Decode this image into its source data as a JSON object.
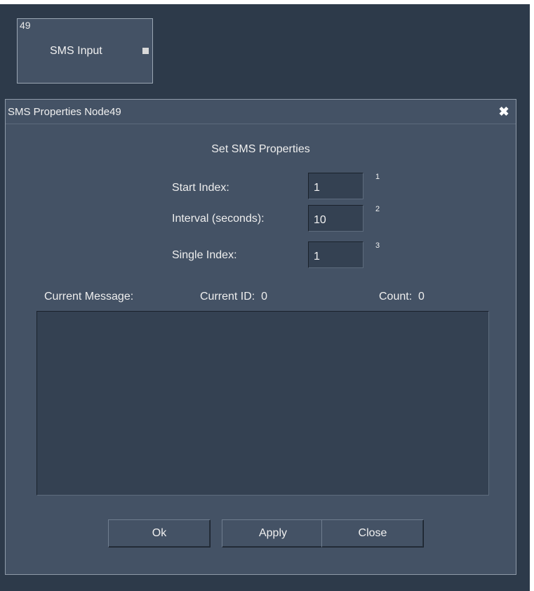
{
  "node": {
    "id": "49",
    "label": "SMS Input"
  },
  "dialog": {
    "title": "SMS Properties Node49",
    "close_glyph": "✖",
    "heading": "Set SMS Properties",
    "fields": [
      {
        "label": "Start Index:",
        "value": "1",
        "shortcut": "1"
      },
      {
        "label": "Interval (seconds):",
        "value": "10",
        "shortcut": "2"
      },
      {
        "label": "Single Index:",
        "value": "1",
        "shortcut": "3"
      }
    ],
    "current_message_label": "Current Message:",
    "current_id_label": "Current ID:  0",
    "count_label": "Count:  0",
    "message_text": "",
    "buttons": {
      "ok": "Ok",
      "apply": "Apply",
      "close": "Close"
    }
  },
  "colors": {
    "background": "#2d3a4a",
    "panel": "#445265",
    "field": "#344152"
  }
}
